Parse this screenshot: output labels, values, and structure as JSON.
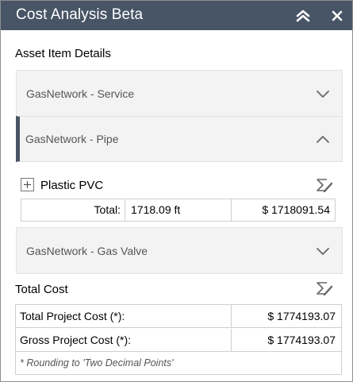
{
  "window": {
    "title": "Cost Analysis Beta"
  },
  "asset_section": {
    "label": "Asset Item Details"
  },
  "accordions": [
    {
      "label": "GasNetwork - Service",
      "state": "collapsed"
    },
    {
      "label": "GasNetwork - Pipe",
      "state": "expanded"
    },
    {
      "label": "GasNetwork - Gas Valve",
      "state": "collapsed"
    }
  ],
  "pipe_details": {
    "material": "Plastic PVC",
    "totals": {
      "label": "Total:",
      "quantity": "1718.09 ft",
      "cost": "$ 1718091.54"
    }
  },
  "total_cost": {
    "label": "Total Cost",
    "rows": [
      {
        "label": "Total Project Cost (*):",
        "value": "$ 1774193.07"
      },
      {
        "label": "Gross Project Cost (*):",
        "value": "$ 1774193.07"
      }
    ],
    "note": "* Rounding to 'Two Decimal Points'"
  },
  "colors": {
    "titlebar": "#485566",
    "accordion_bg": "#f3f3f3",
    "active_marker": "#485566"
  },
  "icons": [
    "chevrons-up-icon",
    "close-icon",
    "chevron-down-icon",
    "chevron-up-icon",
    "plus-box-icon",
    "sigma-edit-icon"
  ]
}
